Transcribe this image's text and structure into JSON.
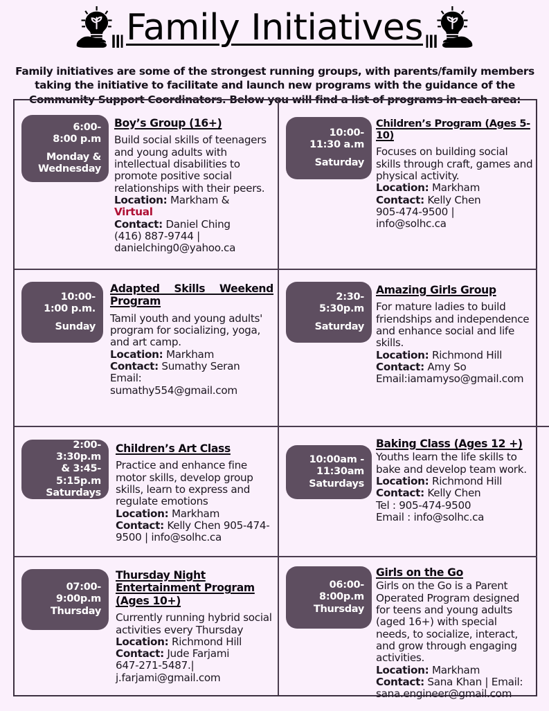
{
  "header": {
    "title": "Family Initiatives",
    "left_icon": "lightbulb-in-hand-icon",
    "right_icon": "lightbulb-in-hand-icon",
    "intro": "Family initiatives are some of the strongest running groups, with parents/family members taking the initiative to facilitate and launch new programs with the guidance of the Community Support Coordinators. Below you will find a list of programs in each area:"
  },
  "colors": {
    "page_background": "#FBF0FC",
    "badge_background": "#5E4E60",
    "badge_text": "#FFFFFF",
    "grid_line": "#4A3C4E",
    "accent_red": "#AE0F33",
    "body_text": "#1C1620"
  },
  "programs": [
    {
      "id": "boys-group",
      "time": "6:00-\n8:00 p.m",
      "time_l1": "6:00-",
      "time_l2": "8:00 p.m",
      "day_l1": "Monday &",
      "day_l2": "Wednesday",
      "title": "Boy’s Group (16+)",
      "description": "Build social skills of teenagers and young adults with intellectual disabilities to promote positive social relationships with their peers.",
      "location_label": "Location:",
      "location": "Markham &",
      "location_extra": "Virtual",
      "contact_label": "Contact:",
      "contact": "Daniel Ching",
      "phone": "(416) 887-9744 |",
      "email": "danielching0@yahoo.ca"
    },
    {
      "id": "childrens-program",
      "time_l1": "10:00-",
      "time_l2": "11:30 a.m",
      "day_l1": "Saturday",
      "day_l2": "",
      "title": "Children’s Program (Ages 5-10)",
      "description": "Focuses on building social skills through craft, games and physical activity.",
      "location_label": "Location:",
      "location": "Markham",
      "contact_label": "Contact:",
      "contact": "Kelly Chen",
      "phone": "905-474-9500 |",
      "email": "info@solhc.ca"
    },
    {
      "id": "adapted-skills-weekend-program",
      "time_l1": "10:00-",
      "time_l2": "1:00 p.m.",
      "day_l1": "Sunday",
      "day_l2": "",
      "title": "Adapted Skills Weekend Program",
      "description": "Tamil youth and young adults' program for socializing, yoga, and art camp.",
      "location_label": "Location:",
      "location": "Markham",
      "contact_label": "Contact:",
      "contact": "Sumathy Seran",
      "email_label": "Email:",
      "email": "sumathy554@gmail.com"
    },
    {
      "id": "amazing-girls-group",
      "time_l1": "2:30-",
      "time_l2": "5:30p.m",
      "day_l1": "Saturday",
      "day_l2": "",
      "title": "Amazing Girls Group",
      "description": "For mature ladies to build friendships and independence and enhance social and life skills.",
      "location_label": "Location:",
      "location": "Richmond Hill",
      "contact_label": "Contact:",
      "contact": "Amy So",
      "email": "Email:iamamyso@gmail.com"
    },
    {
      "id": "childrens-art-class",
      "time_l1": "2:00-3:30p.m",
      "time_l2": "& 3:45-",
      "time_l3": "5:15p.m",
      "day_l1": "Saturdays",
      "day_l2": "",
      "title": "Children’s Art Class",
      "description": "Practice and enhance fine motor skills, develop group skills, learn to express and regulate emotions",
      "location_label": "Location:",
      "location": "Markham",
      "contact_label": "Contact:",
      "contact": "Kelly Chen 905-474-9500 | info@solhc.ca"
    },
    {
      "id": "baking-class",
      "time_l1": "10:00am -",
      "time_l2": "11:30am",
      "day_l1": "Saturdays",
      "day_l2": "",
      "title": "Baking Class (Ages 12 +)",
      "description": "Youths learn the life skills to bake and develop team work.",
      "location_label": "Location:",
      "location": "Richmond Hill",
      "contact_label": "Contact:",
      "contact": "Kelly Chen",
      "phone": "Tel : 905-474-9500",
      "email": "Email : info@solhc.ca"
    },
    {
      "id": "thursday-night-entertainment-program",
      "time_l1": "07:00-",
      "time_l2": "9:00p.m",
      "day_l1": "Thursday",
      "day_l2": "",
      "title": "Thursday Night Entertainment Program (Ages 10+)",
      "description": "Currently running hybrid social activities every Thursday",
      "location_label": "Location:",
      "location": "Richmond Hill",
      "contact_label": "Contact:",
      "contact": "Jude Farjami",
      "phone": "647-271-5487.|",
      "email": "j.farjami@gmail.com"
    },
    {
      "id": "girls-on-the-go",
      "time_l1": "06:00-",
      "time_l2": "8:00p.m",
      "day_l1": "Thursday",
      "day_l2": "",
      "title": "Girls on the Go",
      "description": "Girls on the Go is a Parent Operated Program designed for teens and young adults (aged 16+) with special needs, to socialize, interact, and grow through engaging activities.",
      "location_label": "Location:",
      "location": "Markham",
      "contact_label": "Contact:",
      "contact": "Sana Khan | Email:",
      "email": "sana.engineer@gmail.com"
    }
  ]
}
